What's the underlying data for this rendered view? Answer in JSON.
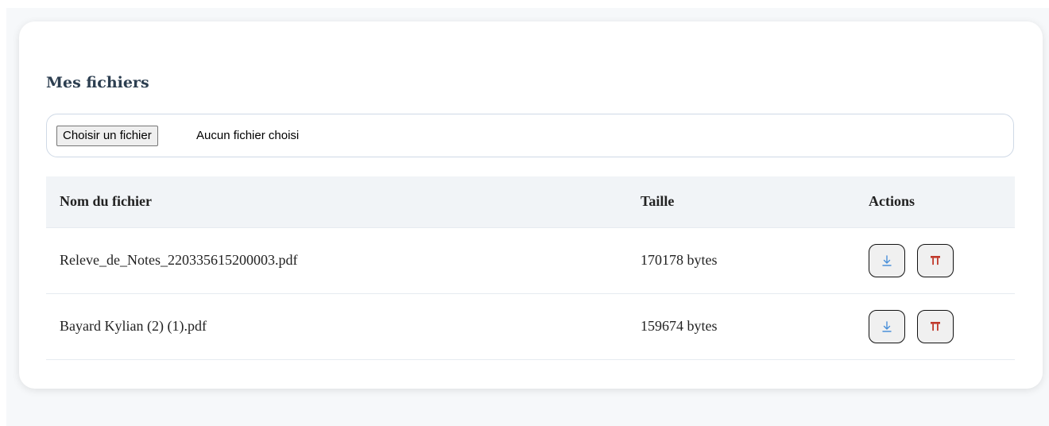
{
  "page": {
    "title": "Mes fichiers"
  },
  "upload": {
    "button_label": "Choisir un fichier",
    "status_text": "Aucun fichier choisi"
  },
  "table": {
    "headers": [
      "Nom du fichier",
      "Taille",
      "Actions"
    ],
    "rows": [
      {
        "name": "Releve_de_Notes_220335615200003.pdf",
        "size": "170178 bytes"
      },
      {
        "name": "Bayard Kylian (2) (1).pdf",
        "size": "159674 bytes"
      }
    ]
  },
  "icons": {
    "download": "download-icon",
    "delete": "trash-icon"
  },
  "colors": {
    "title": "#2c3e50",
    "header_bg": "#f1f4f7",
    "download_icon": "#4a90d9",
    "delete_icon": "#c0392b"
  }
}
